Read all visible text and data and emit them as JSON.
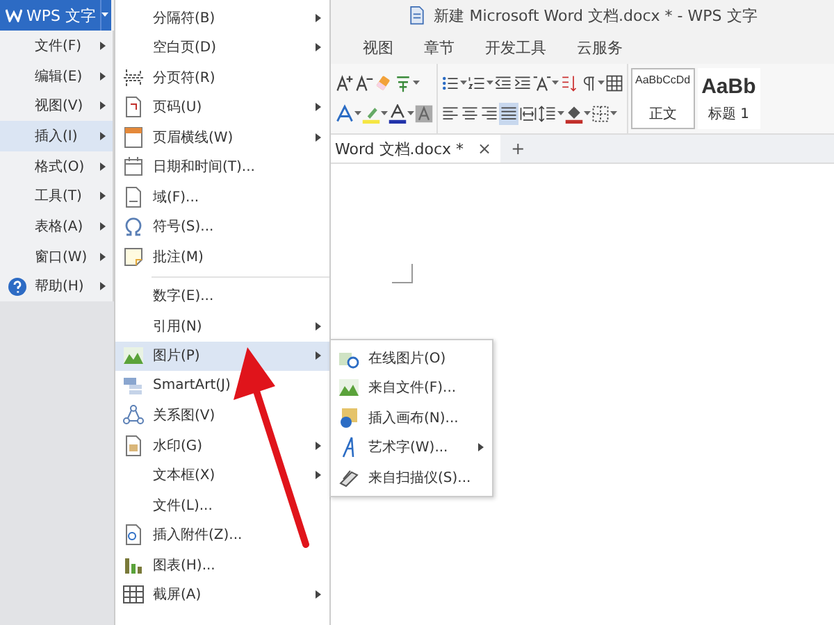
{
  "window": {
    "title": "新建 Microsoft Word 文档.docx * - WPS 文字"
  },
  "app_button": {
    "label": "WPS 文字"
  },
  "ribbon_tabs": [
    {
      "label": "视图",
      "selected": false
    },
    {
      "label": "章节",
      "selected": false
    },
    {
      "label": "开发工具",
      "selected": false
    },
    {
      "label": "云服务",
      "selected": false
    }
  ],
  "paragraph_align": [
    {
      "selected": false
    },
    {
      "selected": false
    },
    {
      "selected": false
    },
    {
      "selected": true
    },
    {
      "selected": false
    }
  ],
  "styles": [
    {
      "sample": "AaBbCcDd",
      "name": "正文",
      "selected": true
    },
    {
      "sample": "AaBb",
      "name": "标题 1",
      "selected": false
    }
  ],
  "document_tabs": [
    {
      "label": "Word 文档.docx *",
      "close": "×"
    }
  ],
  "new_tab": "+",
  "main_menu": [
    {
      "label": "文件(F)",
      "has_submenu": true,
      "selected": false
    },
    {
      "label": "编辑(E)",
      "has_submenu": true,
      "selected": false
    },
    {
      "label": "视图(V)",
      "has_submenu": true,
      "selected": false
    },
    {
      "label": "插入(I)",
      "has_submenu": true,
      "selected": true
    },
    {
      "label": "格式(O)",
      "has_submenu": true,
      "selected": false
    },
    {
      "label": "工具(T)",
      "has_submenu": true,
      "selected": false
    },
    {
      "label": "表格(A)",
      "has_submenu": true,
      "selected": false
    },
    {
      "label": "窗口(W)",
      "has_submenu": true,
      "selected": false
    },
    {
      "label": "帮助(H)",
      "has_submenu": true,
      "selected": false
    }
  ],
  "insert_menu": [
    [
      {
        "label": "分隔符(B)",
        "has_submenu": true,
        "selected": false
      },
      {
        "label": "空白页(D)",
        "has_submenu": true,
        "selected": false
      },
      {
        "label": "分页符(R)",
        "has_submenu": false,
        "selected": false
      },
      {
        "label": "页码(U)",
        "has_submenu": true,
        "selected": false
      },
      {
        "label": "页眉横线(W)",
        "has_submenu": true,
        "selected": false
      },
      {
        "label": "日期和时间(T)...",
        "has_submenu": false,
        "selected": false
      },
      {
        "label": "域(F)...",
        "has_submenu": false,
        "selected": false
      },
      {
        "label": "符号(S)...",
        "has_submenu": false,
        "selected": false
      },
      {
        "label": "批注(M)",
        "has_submenu": false,
        "selected": false
      }
    ],
    [
      {
        "label": "数字(E)...",
        "has_submenu": false,
        "selected": false
      },
      {
        "label": "引用(N)",
        "has_submenu": true,
        "selected": false
      },
      {
        "label": "图片(P)",
        "has_submenu": true,
        "selected": true
      },
      {
        "label": "SmartArt(J)",
        "has_submenu": false,
        "selected": false
      },
      {
        "label": "关系图(V)",
        "has_submenu": false,
        "selected": false
      },
      {
        "label": "水印(G)",
        "has_submenu": true,
        "selected": false
      },
      {
        "label": "文本框(X)",
        "has_submenu": true,
        "selected": false
      },
      {
        "label": "文件(L)...",
        "has_submenu": false,
        "selected": false
      },
      {
        "label": "插入附件(Z)...",
        "has_submenu": false,
        "selected": false
      },
      {
        "label": "图表(H)...",
        "has_submenu": false,
        "selected": false
      },
      {
        "label": "截屏(A)",
        "has_submenu": true,
        "selected": false
      }
    ]
  ],
  "picture_submenu": [
    {
      "label": "在线图片(O)",
      "has_submenu": false,
      "selected": false
    },
    {
      "label": "来自文件(F)...",
      "has_submenu": false,
      "selected": false
    },
    {
      "label": "插入画布(N)...",
      "has_submenu": false,
      "selected": false
    },
    {
      "label": "艺术字(W)...",
      "has_submenu": true,
      "selected": false
    },
    {
      "label": "来自扫描仪(S)...",
      "has_submenu": false,
      "selected": false
    }
  ]
}
